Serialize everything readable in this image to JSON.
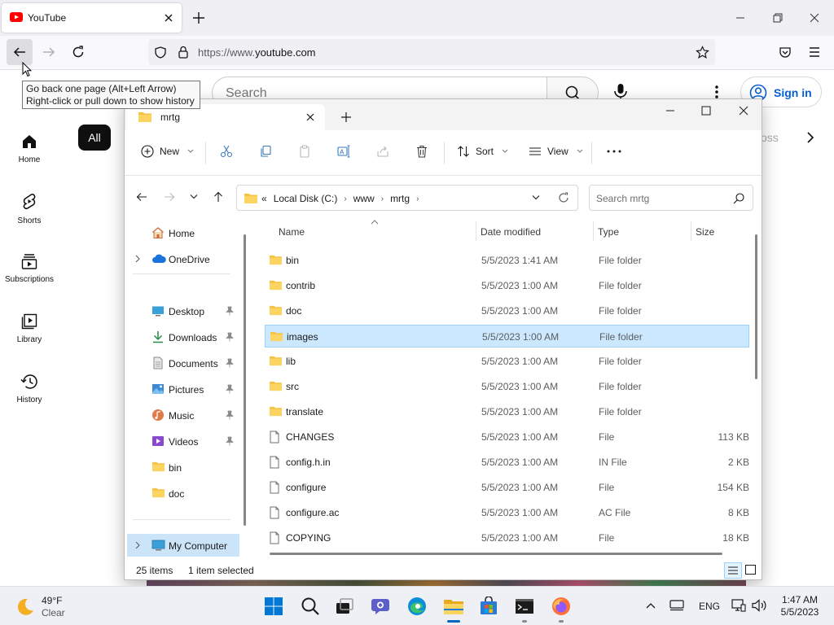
{
  "browser": {
    "tab_title": "YouTube",
    "url_prefix": "https://www.",
    "url_domain": "youtube.com",
    "tooltip_line1": "Go back one page (Alt+Left Arrow)",
    "tooltip_line2": "Right-click or pull down to show history"
  },
  "youtube": {
    "search_placeholder": "Search",
    "sign_in": "Sign in",
    "nav": [
      {
        "label": "Home",
        "icon": "home-icon"
      },
      {
        "label": "Shorts",
        "icon": "shorts-icon"
      },
      {
        "label": "Subscriptions",
        "icon": "subscriptions-icon"
      },
      {
        "label": "Library",
        "icon": "library-icon"
      },
      {
        "label": "History",
        "icon": "history-icon"
      }
    ],
    "chip_all": "All",
    "chip_partial": "oss"
  },
  "explorer": {
    "tab_title": "mrtg",
    "toolbar": {
      "new": "New",
      "sort": "Sort",
      "view": "View"
    },
    "breadcrumb": [
      "Local Disk (C:)",
      "www",
      "mrtg"
    ],
    "breadcrumb_prefix": "«",
    "search_placeholder": "Search mrtg",
    "nav": {
      "home": "Home",
      "onedrive": "OneDrive",
      "quick": [
        {
          "label": "Desktop",
          "pinned": true
        },
        {
          "label": "Downloads",
          "pinned": true
        },
        {
          "label": "Documents",
          "pinned": true
        },
        {
          "label": "Pictures",
          "pinned": true
        },
        {
          "label": "Music",
          "pinned": true
        },
        {
          "label": "Videos",
          "pinned": true
        },
        {
          "label": "bin",
          "pinned": false
        },
        {
          "label": "doc",
          "pinned": false
        }
      ],
      "my_computer": "My Computer"
    },
    "columns": {
      "name": "Name",
      "date": "Date modified",
      "type": "Type",
      "size": "Size"
    },
    "files": [
      {
        "name": "bin",
        "date": "5/5/2023 1:41 AM",
        "type": "File folder",
        "size": "",
        "kind": "folder"
      },
      {
        "name": "contrib",
        "date": "5/5/2023 1:00 AM",
        "type": "File folder",
        "size": "",
        "kind": "folder"
      },
      {
        "name": "doc",
        "date": "5/5/2023 1:00 AM",
        "type": "File folder",
        "size": "",
        "kind": "folder"
      },
      {
        "name": "images",
        "date": "5/5/2023 1:00 AM",
        "type": "File folder",
        "size": "",
        "kind": "folder",
        "selected": true
      },
      {
        "name": "lib",
        "date": "5/5/2023 1:00 AM",
        "type": "File folder",
        "size": "",
        "kind": "folder"
      },
      {
        "name": "src",
        "date": "5/5/2023 1:00 AM",
        "type": "File folder",
        "size": "",
        "kind": "folder"
      },
      {
        "name": "translate",
        "date": "5/5/2023 1:00 AM",
        "type": "File folder",
        "size": "",
        "kind": "folder"
      },
      {
        "name": "CHANGES",
        "date": "5/5/2023 1:00 AM",
        "type": "File",
        "size": "113 KB",
        "kind": "file"
      },
      {
        "name": "config.h.in",
        "date": "5/5/2023 1:00 AM",
        "type": "IN File",
        "size": "2 KB",
        "kind": "file"
      },
      {
        "name": "configure",
        "date": "5/5/2023 1:00 AM",
        "type": "File",
        "size": "154 KB",
        "kind": "file"
      },
      {
        "name": "configure.ac",
        "date": "5/5/2023 1:00 AM",
        "type": "AC File",
        "size": "8 KB",
        "kind": "file"
      },
      {
        "name": "COPYING",
        "date": "5/5/2023 1:00 AM",
        "type": "File",
        "size": "18 KB",
        "kind": "file"
      }
    ],
    "status_count": "25 items",
    "status_selected": "1 item selected"
  },
  "taskbar": {
    "weather_temp": "49°F",
    "weather_cond": "Clear",
    "lang": "ENG",
    "time": "1:47 AM",
    "date": "5/5/2023"
  },
  "colors": {
    "accent": "#0067c0",
    "selection": "#cce8ff",
    "folder": "#f5c242",
    "youtube_red": "#ff0000",
    "link_blue": "#065fd4"
  }
}
